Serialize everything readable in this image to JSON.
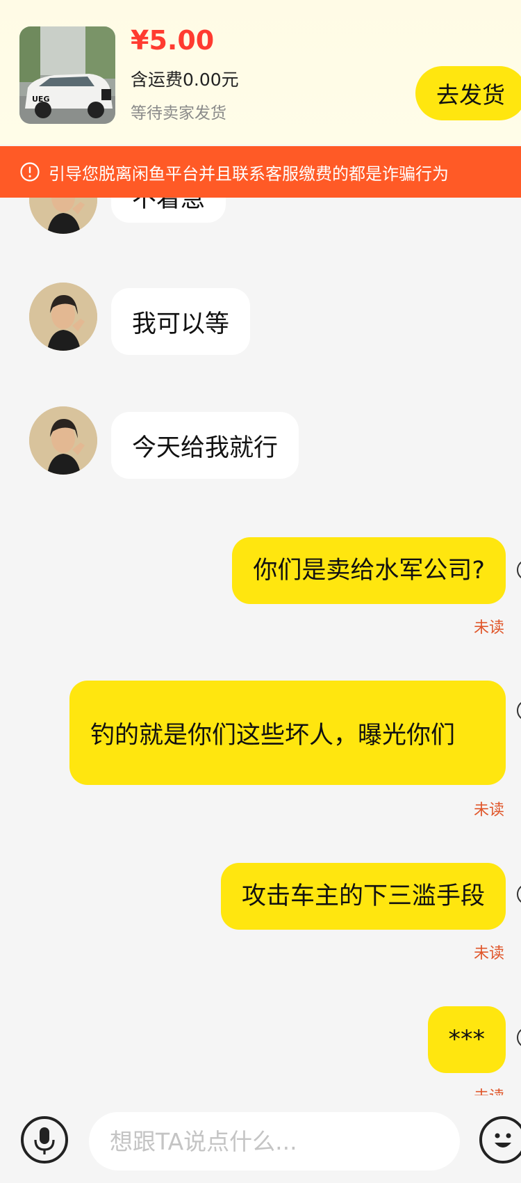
{
  "order": {
    "price": "¥5.00",
    "shipping_text": "含运费0.00元",
    "status": "等待卖家发货",
    "ship_button": "去发货",
    "product_image_text": "UEG"
  },
  "warning": {
    "text": "引导您脱离闲鱼平台并且联系客服缴费的都是诈骗行为",
    "icon": "info-circle-icon",
    "color": "#ff5a26"
  },
  "messages": [
    {
      "side": "in",
      "text": "不着急"
    },
    {
      "side": "in",
      "text": "我可以等"
    },
    {
      "side": "in",
      "text": "今天给我就行"
    },
    {
      "side": "out",
      "text": "你们是卖给水军公司?",
      "status": "未读"
    },
    {
      "side": "out",
      "text": "钓的就是你们这些坏人，曝光你们",
      "status": "未读"
    },
    {
      "side": "out",
      "text": "攻击车主的下三滥手段",
      "status": "未读"
    },
    {
      "side": "out",
      "text": "***",
      "status": "未读"
    }
  ],
  "input": {
    "placeholder": "想跟TA说点什么...",
    "voice_icon": "microphone-icon",
    "emoji_icon": "emoji-icon"
  },
  "colors": {
    "accent_yellow": "#ffe60f",
    "price_red": "#ff3b30",
    "unread_orange": "#e0562a"
  }
}
